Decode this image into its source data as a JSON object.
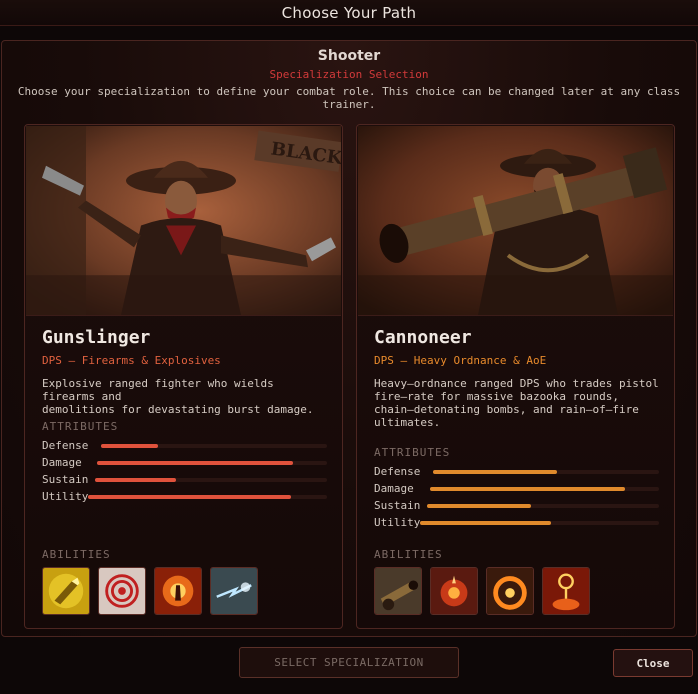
{
  "window": {
    "title": "Choose Your Path"
  },
  "header": {
    "class_name": "Shooter",
    "subtitle": "Specialization Selection",
    "description": "Choose your specialization to define your combat role. This choice can be changed later at any class trainer."
  },
  "colors": {
    "accent_red": "#d23a3a",
    "gunslinger_bar": "#e0523c",
    "cannoneer_bar": "#e08a2c"
  },
  "specs": [
    {
      "name": "Gunslinger",
      "role": "DPS — Firearms & Explosives",
      "description": "Explosive ranged fighter who wields firearms and\ndemolitions for devastating burst damage.",
      "attributes_label": "ATTRIBUTES",
      "attributes": [
        {
          "label": "Defense",
          "value": 0.25
        },
        {
          "label": "Damage",
          "value": 0.85
        },
        {
          "label": "Sustain",
          "value": 0.35
        },
        {
          "label": "Utility",
          "value": 0.85
        }
      ],
      "abilities_label": "ABILITIES",
      "abilities": [
        "golden-bullet-icon",
        "target-reticle-icon",
        "fire-explosion-icon",
        "electric-shot-icon"
      ]
    },
    {
      "name": "Cannoneer",
      "role": "DPS — Heavy Ordnance & AoE",
      "description": "Heavy—ordnance ranged DPS who trades pistol\nfire—rate for massive bazooka rounds,\nchain—detonating bombs, and rain—of—fire\n ultimates.",
      "attributes_label": "ATTRIBUTES",
      "attributes": [
        {
          "label": "Defense",
          "value": 0.55
        },
        {
          "label": "Damage",
          "value": 0.85
        },
        {
          "label": "Sustain",
          "value": 0.45
        },
        {
          "label": "Utility",
          "value": 0.55
        }
      ],
      "abilities_label": "ABILITIES",
      "abilities": [
        "cannon-icon",
        "bomb-blast-icon",
        "fire-ring-icon",
        "rain-of-fire-icon"
      ]
    }
  ],
  "footer": {
    "select_label": "SELECT SPECIALIZATION",
    "close_label": "Close"
  }
}
